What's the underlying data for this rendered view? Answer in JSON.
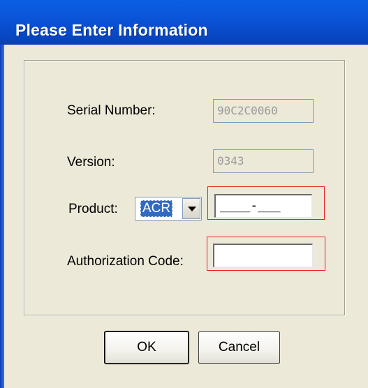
{
  "window": {
    "title": "Please Enter Information"
  },
  "form": {
    "serial_label": "Serial Number:",
    "serial_value": "90C2C0060",
    "version_label": "Version:",
    "version_value": "0343",
    "product_label": "Product:",
    "product_selected": "ACR",
    "product_code_value": "____-___",
    "auth_label": "Authorization Code:",
    "auth_value": ""
  },
  "buttons": {
    "ok_label": "OK",
    "cancel_label": "Cancel"
  },
  "icons": {
    "combo_arrow": "chevron-down-icon"
  },
  "colors": {
    "titlebar": "#0a54d8",
    "dialog_bg": "#ece9d8",
    "highlight": "#e52020",
    "selection": "#316ac5"
  }
}
